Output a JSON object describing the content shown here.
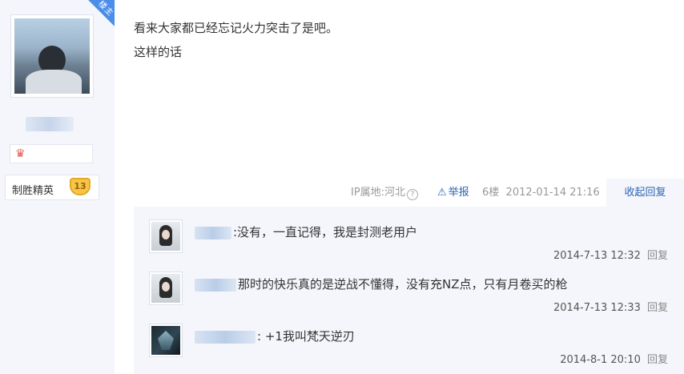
{
  "author": {
    "badge": "楼主",
    "level_title": "制胜精英",
    "level_number": "13",
    "icon": "red-badge-icon"
  },
  "post": {
    "lines": [
      "看来大家都已经忘记火力突击了是吧。",
      "这样的话"
    ],
    "ip_location": "IP属地:河北",
    "report_label": "举报",
    "floor": "6楼",
    "date": "2012-01-14 21:16",
    "collapse_label": "收起回复"
  },
  "replies": [
    {
      "text": ":没有，一直记得，我是封测老用户",
      "time": "2014-7-13 12:32",
      "reply_label": "回复",
      "avatar": "girl-avatar"
    },
    {
      "text": "那时的快乐真的是逆战不懂得，没有充NZ点，只有月卷买的枪",
      "time": "2014-7-13 12:33",
      "reply_label": "回复",
      "avatar": "girl-avatar"
    },
    {
      "text": ": +1我叫梵天逆刃",
      "time": "2014-8-1 20:10",
      "reply_label": "回复",
      "avatar": "dark-avatar"
    }
  ],
  "colors": {
    "link": "#2d64b3",
    "panel": "#f4f6fb",
    "badge": "#4a8eea"
  }
}
